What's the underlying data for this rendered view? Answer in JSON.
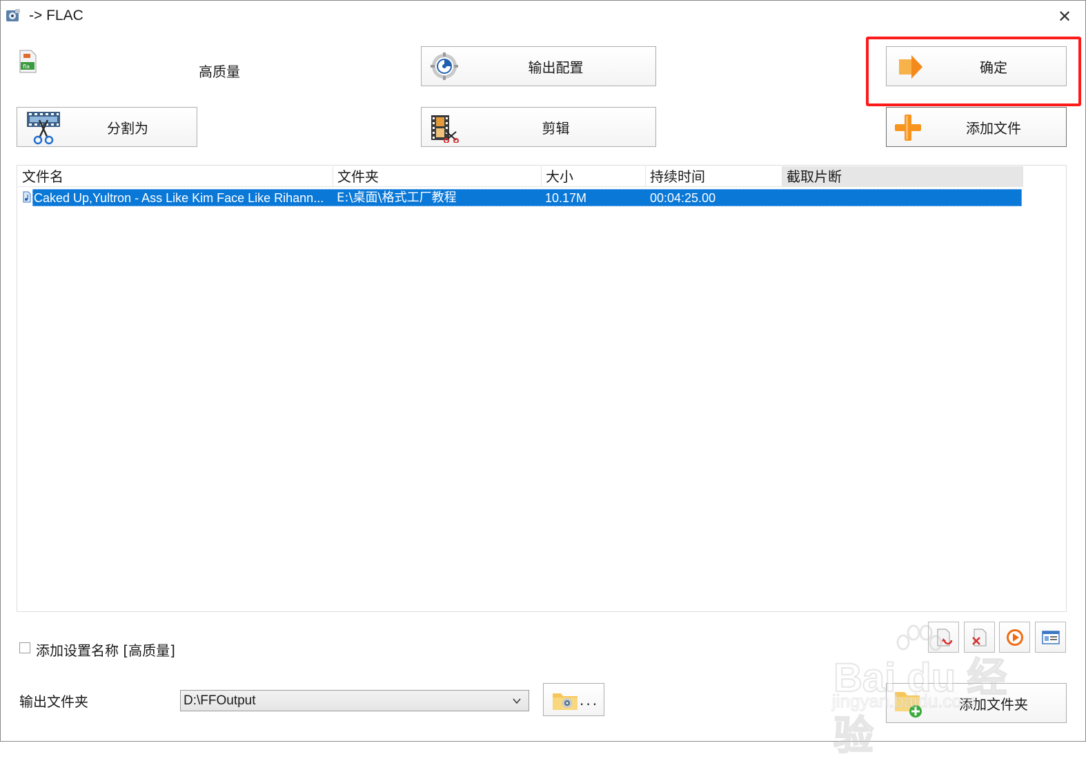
{
  "window": {
    "title": "-> FLAC",
    "close_glyph": "✕"
  },
  "quality": {
    "label": "高质量"
  },
  "buttons": {
    "output_config": "输出配置",
    "ok": "确定",
    "split": "分割为",
    "clip": "剪辑",
    "add_file": "添加文件",
    "add_folder": "添加文件夹",
    "browse": "..."
  },
  "file_list": {
    "columns": [
      "文件名",
      "文件夹",
      "大小",
      "持续时间",
      "截取片断"
    ],
    "rows": [
      {
        "name": "Caked Up,Yultron - Ass Like Kim Face Like Rihann...",
        "folder": "E:\\桌面\\格式工厂教程",
        "size": "10.17M",
        "duration": "00:04:25.00",
        "clip": ""
      }
    ]
  },
  "add_setting_name": {
    "label": "添加设置名称 [高质量]",
    "checked": false
  },
  "output_folder": {
    "label": "输出文件夹",
    "value": "D:\\FFOutput"
  },
  "watermark": {
    "line1": "Bai du 经验",
    "line2": "jingyan.baidu.com"
  },
  "colors": {
    "selection": "#0a78d7",
    "highlight_border": "#ff1a1a",
    "plus_orange": "#f7941d"
  },
  "icons": [
    "app-icon",
    "close-icon",
    "flac-file-icon",
    "gear-icon",
    "arrow-right-icon",
    "scissors-film-icon",
    "film-clip-icon",
    "plus-icon",
    "audio-file-icon",
    "chevron-down-icon",
    "folder-browse-icon",
    "remove-icon",
    "delete-icon",
    "play-icon",
    "info-icon",
    "folder-add-icon"
  ]
}
